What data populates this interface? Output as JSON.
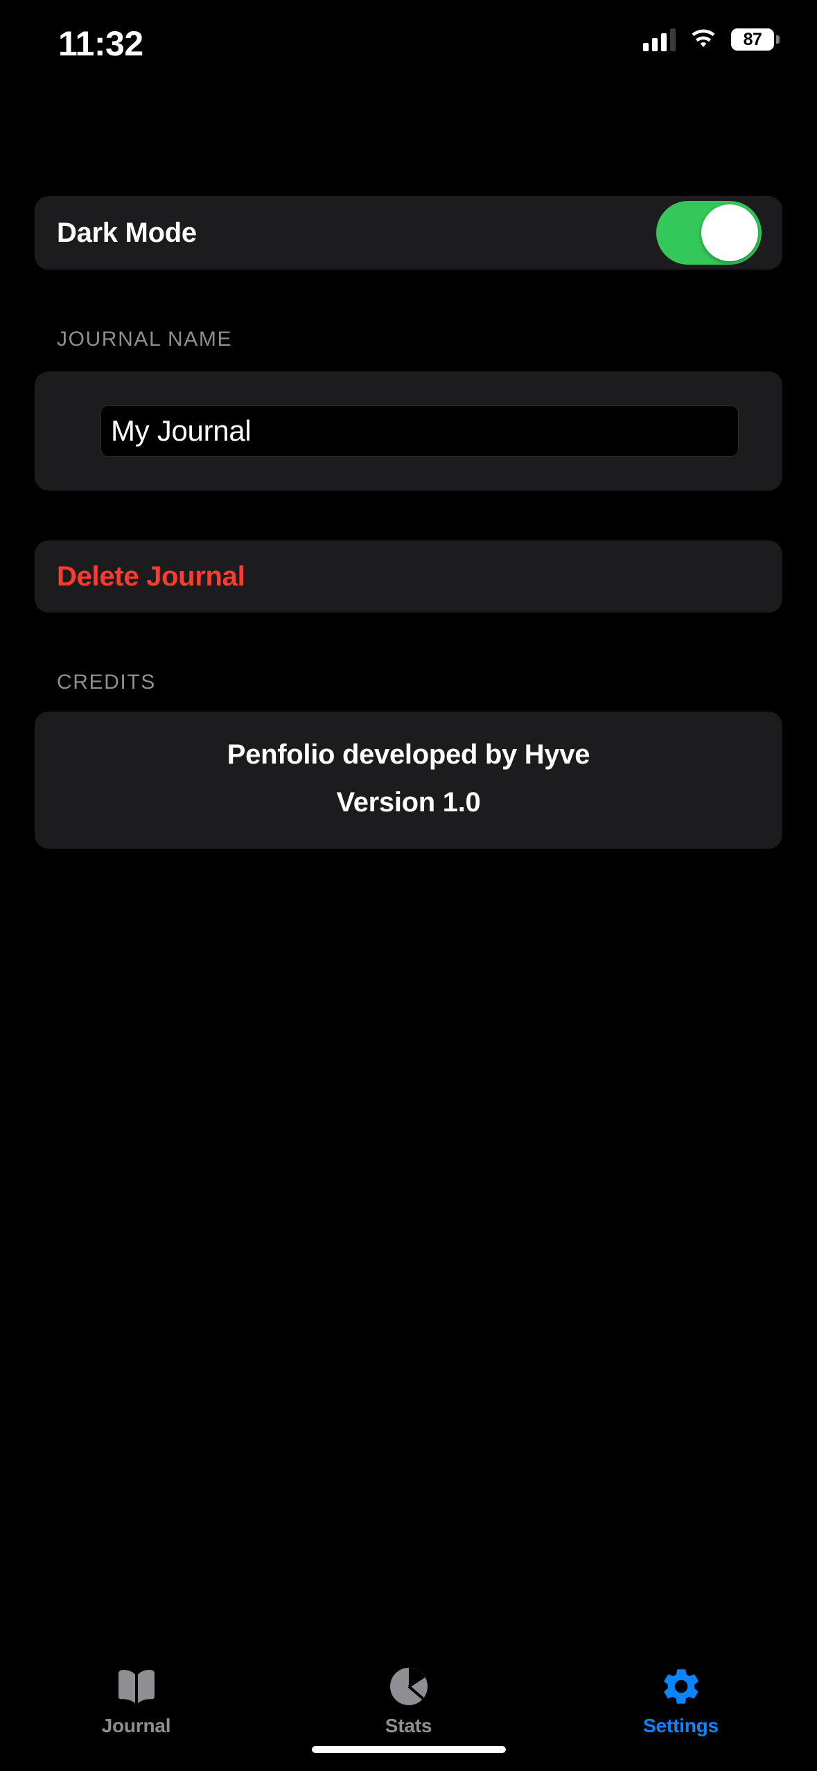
{
  "status_bar": {
    "time": "11:32",
    "battery_percent": "87",
    "cellular_icon": "cellular-bars-icon",
    "wifi_icon": "wifi-icon",
    "battery_icon": "battery-icon"
  },
  "settings": {
    "dark_mode": {
      "label": "Dark Mode",
      "enabled": true,
      "toggle_on_color": "#34C759",
      "knob_color": "#FFFFFF"
    },
    "journal_name": {
      "section_label": "JOURNAL NAME",
      "value": "My Journal",
      "placeholder": "My Journal"
    },
    "delete": {
      "label": "Delete Journal",
      "color": "#FF3B30"
    },
    "credits": {
      "section_label": "CREDITS",
      "lines": [
        "Penfolio developed by Hyve",
        "Version 1.0"
      ]
    }
  },
  "tab_bar": {
    "active_color": "#0A84FF",
    "inactive_color": "#8E8E93",
    "tabs": [
      {
        "label": "Journal",
        "icon": "book-icon",
        "active": false
      },
      {
        "label": "Stats",
        "icon": "pie-chart-icon",
        "active": false
      },
      {
        "label": "Settings",
        "icon": "gear-icon",
        "active": true
      }
    ]
  },
  "theme": {
    "background": "#000000",
    "card_background": "#1C1C1E",
    "label_color": "#8E8E93",
    "text_color": "#FFFFFF"
  }
}
